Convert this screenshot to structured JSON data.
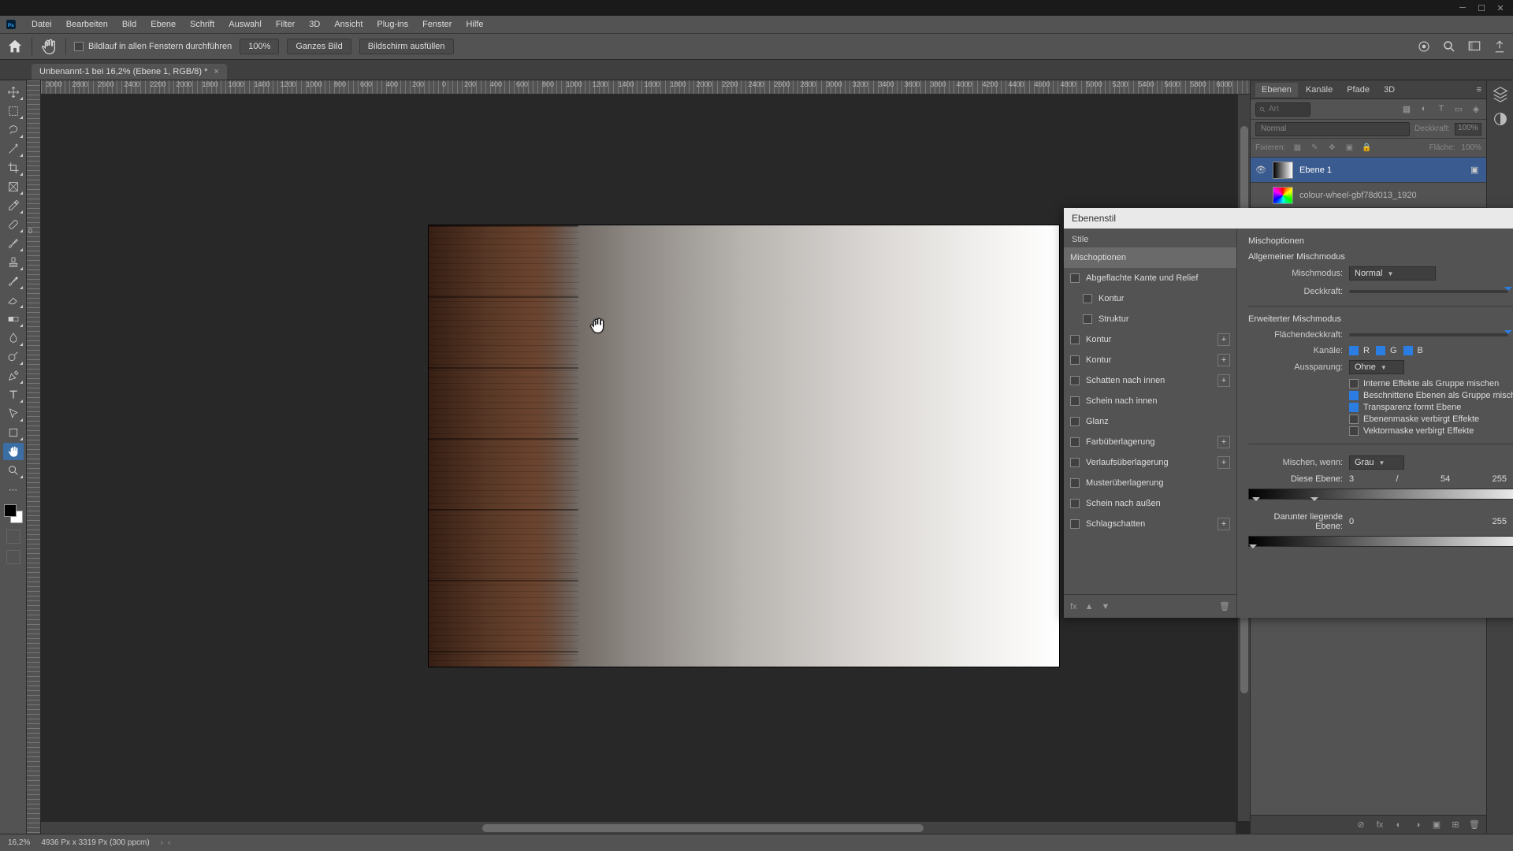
{
  "menu": [
    "Datei",
    "Bearbeiten",
    "Bild",
    "Ebene",
    "Schrift",
    "Auswahl",
    "Filter",
    "3D",
    "Ansicht",
    "Plug-ins",
    "Fenster",
    "Hilfe"
  ],
  "options": {
    "scroll_all": "Bildlauf in allen Fenstern durchführen",
    "zoom100": "100%",
    "fit": "Ganzes Bild",
    "fill": "Bildschirm ausfüllen"
  },
  "doc": {
    "tab": "Unbenannt-1 bei 16,2% (Ebene 1, RGB/8) *"
  },
  "ruler": {
    "labels": [
      "3000",
      "2800",
      "2600",
      "2400",
      "2200",
      "2000",
      "1800",
      "1600",
      "1400",
      "1200",
      "1000",
      "800",
      "600",
      "400",
      "200",
      "0",
      "200",
      "400",
      "600",
      "800",
      "1000",
      "1200",
      "1400",
      "1600",
      "1800",
      "2000",
      "2200",
      "2400",
      "2600",
      "2800",
      "3000",
      "3200",
      "3400",
      "3600",
      "3800",
      "4000",
      "4200",
      "4400",
      "4600",
      "4800",
      "5000",
      "5200",
      "5400",
      "5600",
      "5800",
      "6000"
    ],
    "vzero": "0"
  },
  "panels": {
    "tabs": [
      "Ebenen",
      "Kanäle",
      "Pfade",
      "3D"
    ],
    "search_ph": "Art",
    "blendmode": "Normal",
    "opacity_label": "Deckkraft:",
    "opacity_val": "100%",
    "lock_label": "Fixieren:",
    "fill_label": "Fläche:",
    "fill_val": "100%",
    "layers": [
      {
        "name": "Ebene 1"
      },
      {
        "name": "colour-wheel-gbf78d013_1920"
      }
    ]
  },
  "dialog": {
    "title": "Ebenenstil",
    "left_header": "Stile",
    "rows": [
      {
        "label": "Mischoptionen",
        "sel": true
      },
      {
        "label": "Abgeflachte Kante und Relief",
        "cb": true
      },
      {
        "label": "Kontur",
        "cb": true,
        "sub": true
      },
      {
        "label": "Struktur",
        "cb": true,
        "sub": true
      },
      {
        "label": "Kontur",
        "cb": true,
        "plus": true
      },
      {
        "label": "Kontur",
        "cb": true,
        "plus": true
      },
      {
        "label": "Schatten nach innen",
        "cb": true,
        "plus": true
      },
      {
        "label": "Schein nach innen",
        "cb": true
      },
      {
        "label": "Glanz",
        "cb": true
      },
      {
        "label": "Farbüberlagerung",
        "cb": true,
        "plus": true
      },
      {
        "label": "Verlaufsüberlagerung",
        "cb": true,
        "plus": true
      },
      {
        "label": "Musterüberlagerung",
        "cb": true
      },
      {
        "label": "Schein nach außen",
        "cb": true
      },
      {
        "label": "Schlagschatten",
        "cb": true,
        "plus": true
      }
    ],
    "right": {
      "section": "Mischoptionen",
      "general": "Allgemeiner Mischmodus",
      "mode_label": "Mischmodus:",
      "mode_value": "Normal",
      "opacity_label": "Deckkraft:",
      "opacity_value": "100",
      "adv": "Erweiterter Mischmodus",
      "fillop_label": "Flächendeckkraft:",
      "fillop_value": "100",
      "channels_label": "Kanäle:",
      "ch_r": "R",
      "ch_g": "G",
      "ch_b": "B",
      "knockout_label": "Aussparung:",
      "knockout_value": "Ohne",
      "opts": [
        {
          "on": false,
          "label": "Interne Effekte als Gruppe mischen"
        },
        {
          "on": true,
          "label": "Beschnittene Ebenen als Gruppe mischen"
        },
        {
          "on": true,
          "label": "Transparenz formt Ebene"
        },
        {
          "on": false,
          "label": "Ebenenmaske verbirgt Effekte"
        },
        {
          "on": false,
          "label": "Vektormaske verbirgt Effekte"
        }
      ],
      "blendif_label": "Mischen, wenn:",
      "blendif_value": "Grau",
      "this_label": "Diese Ebene:",
      "this_a": "3",
      "this_sep": "/",
      "this_b": "54",
      "this_c": "255",
      "under_label": "Darunter liegende Ebene:",
      "under_a": "0",
      "under_b": "255"
    }
  },
  "status": {
    "zoom": "16,2%",
    "info": "4936 Px x 3319 Px (300 ppcm)"
  }
}
